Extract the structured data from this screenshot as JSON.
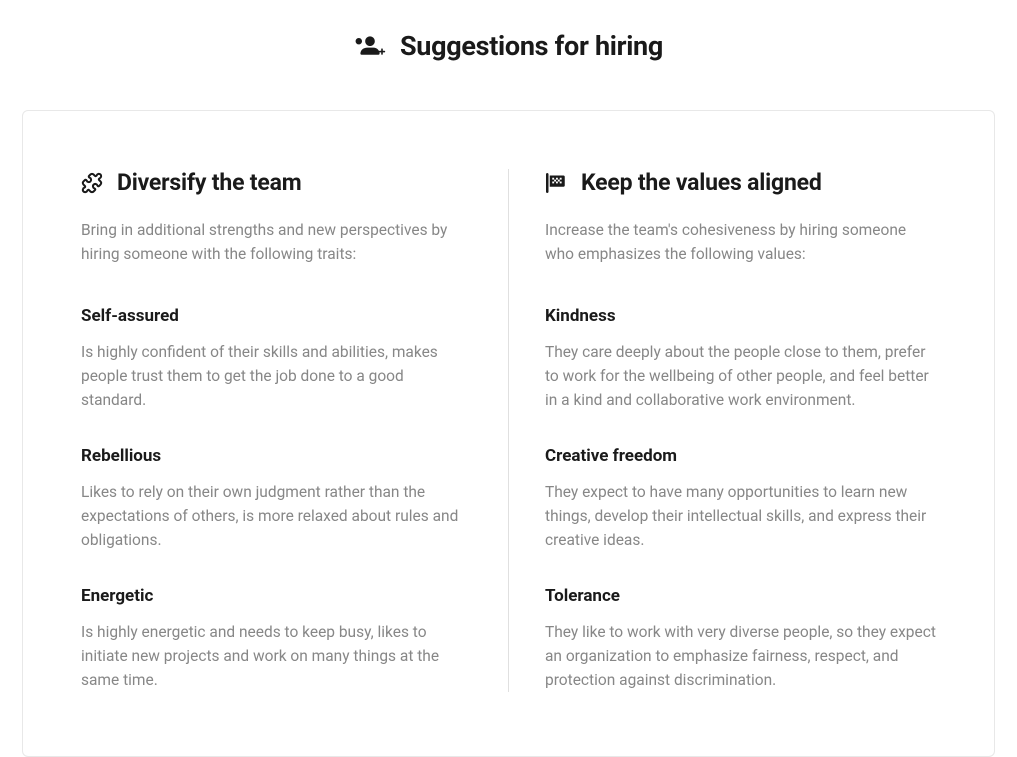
{
  "header": {
    "title": "Suggestions for hiring"
  },
  "left": {
    "title": "Diversify the team",
    "intro": "Bring in additional strengths and new perspectives by hiring someone with the following traits:",
    "traits": [
      {
        "name": "Self-assured",
        "desc": "Is highly confident of their skills and abilities, makes people trust them to get the job done to a good standard."
      },
      {
        "name": "Rebellious",
        "desc": "Likes to rely on their own judgment rather than the expectations of others, is more relaxed about rules and obligations."
      },
      {
        "name": "Energetic",
        "desc": "Is highly energetic and needs to keep busy, likes to initiate new projects and work on many things at the same time."
      }
    ]
  },
  "right": {
    "title": "Keep the values aligned",
    "intro": "Increase the team's cohesiveness by hiring someone who emphasizes the following values:",
    "traits": [
      {
        "name": "Kindness",
        "desc": "They care deeply about the people close to them, prefer to work for the wellbeing of other people, and feel better in a kind and collaborative work environment."
      },
      {
        "name": "Creative freedom",
        "desc": "They expect to have many opportunities to learn new things, develop their intellectual skills, and express their creative ideas."
      },
      {
        "name": "Tolerance",
        "desc": "They like to work with very diverse people, so they expect an organization to emphasize fairness, respect, and protection against discrimination."
      }
    ]
  }
}
